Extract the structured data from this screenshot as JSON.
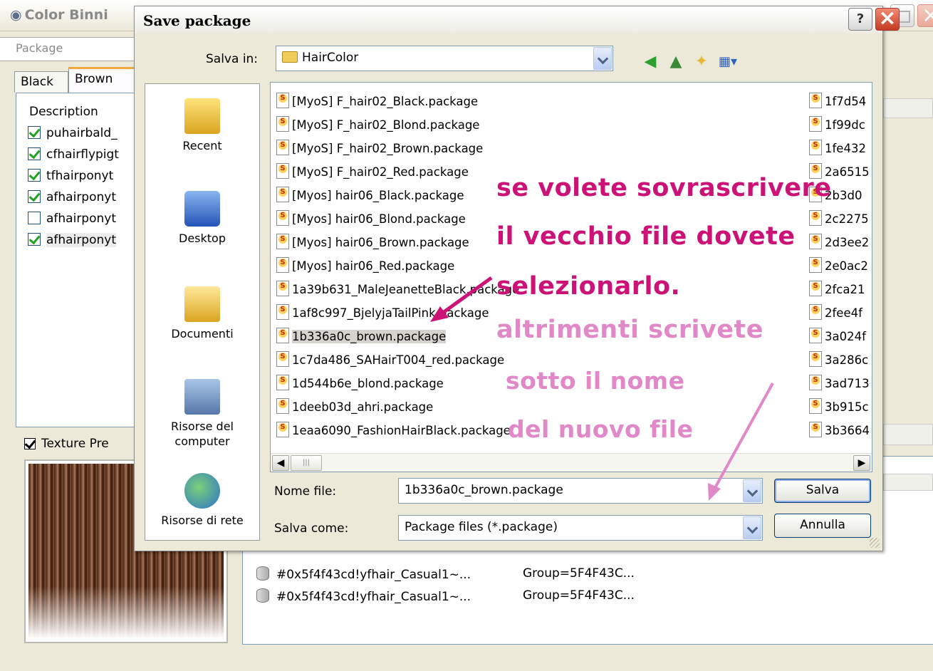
{
  "app": {
    "title": "Color Binni",
    "package_label": "Package",
    "tabs": [
      "Black",
      "Brown"
    ],
    "list_header": "Description",
    "items": [
      {
        "label": "puhairbald_",
        "checked": true
      },
      {
        "label": "cfhairflypigt",
        "checked": true
      },
      {
        "label": "tfhairponyt",
        "checked": true
      },
      {
        "label": "afhairponyt",
        "checked": true
      },
      {
        "label": "afhairponyt",
        "checked": false
      },
      {
        "label": "afhairponyt",
        "checked": true
      }
    ],
    "texture_preview_label": "Texture Pre",
    "resources": [
      {
        "name": "#0x5f4f43cd!yfhair_Casual1~...",
        "group": "Group=5F4F43C..."
      },
      {
        "name": "#0x5f4f43cd!yfhair_Casual1~...",
        "group": "Group=5F4F43C..."
      }
    ]
  },
  "dialog": {
    "title": "Save package",
    "help_label": "?",
    "close_label": "×",
    "save_in_label": "Salva in:",
    "save_in_value": "HairColor",
    "places": [
      "Recent",
      "Desktop",
      "Documenti",
      "Risorse del computer",
      "Risorse di rete"
    ],
    "files": [
      "[MyoS] F_hair02_Black.package",
      "[MyoS] F_hair02_Blond.package",
      "[MyoS] F_hair02_Brown.package",
      "[MyoS] F_hair02_Red.package",
      "[Myos] hair06_Black.package",
      "[Myos] hair06_Blond.package",
      "[Myos] hair06_Brown.package",
      "[Myos] hair06_Red.package",
      "1a39b631_MaleJeanetteBlack.package",
      "1af8c997_BjelyjaTailPink.package",
      "1b336a0c_brown.package",
      "1c7da486_SAHairT004_red.package",
      "1d544b6e_blond.package",
      "1deeb03d_ahri.package",
      "1eaa6090_FashionHairBlack.package"
    ],
    "selected_file": "1b336a0c_brown.package",
    "files_col2": [
      "1f7d54",
      "1f99dc",
      "1fe432",
      "2a6515",
      "2b3d0",
      "2c2275",
      "2d3ee2",
      "2e0ac2",
      "2fca21",
      "2fee4f",
      "3a024f",
      "3a286c",
      "3ad713",
      "3b915c",
      "3b3664"
    ],
    "filename_label": "Nome file:",
    "filename_value": "1b336a0c_brown.package",
    "savetype_label": "Salva come:",
    "savetype_value": "Package files (*.package)",
    "save_button": "Salva",
    "cancel_button": "Annulla"
  },
  "annotations": {
    "line1": "se volete sovrascrivere",
    "line2": "il vecchio file dovete",
    "line3": "selezionarlo.",
    "line4": "altrimenti scrivete",
    "line5": "sotto il nome",
    "line6": "del nuovo file"
  },
  "colors": {
    "annotation_magenta": "#cc1177",
    "annotation_pink": "#e088c8",
    "selection_gray": "#d6d3ce"
  }
}
